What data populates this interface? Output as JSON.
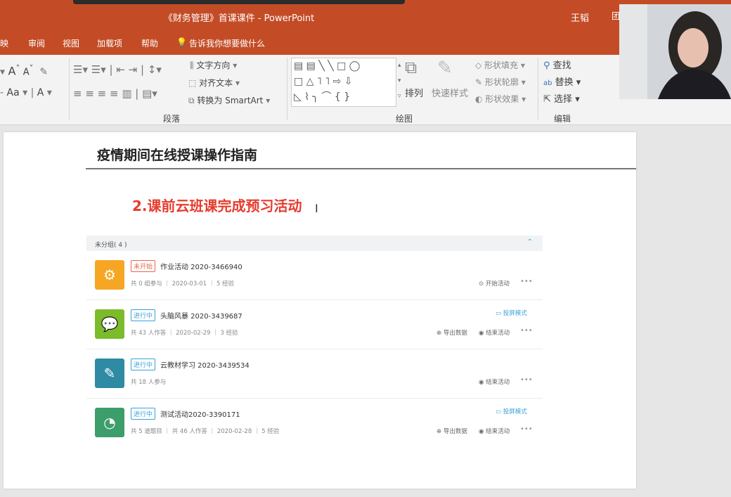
{
  "window": {
    "title": "《财务管理》首课课件 - PowerPoint",
    "user": "王韬",
    "extra": "团"
  },
  "menu": [
    "映",
    "审阅",
    "视图",
    "加载项",
    "帮助",
    "告诉我你想要做什么"
  ],
  "ribbon": {
    "font_group": {
      "grow": "A",
      "shrink": "A",
      "aa": "Aa",
      "a": "A"
    },
    "paragraph": {
      "text_direction": "文字方向",
      "align_text": "对齐文本",
      "smartart": "转换为 SmartArt",
      "label": "段落"
    },
    "drawing": {
      "arrange": "排列",
      "quick_styles": "快速样式",
      "shape_fill": "形状填充",
      "shape_outline": "形状轮廓",
      "shape_effects": "形状效果",
      "label": "绘图"
    },
    "editing": {
      "find": "查找",
      "replace": "替换",
      "select": "选择",
      "label": "编辑"
    }
  },
  "slide": {
    "title": "疫情期间在线授课操作指南",
    "subtitle": "2.课前云班课完成预习活动",
    "panel": {
      "group_label": "未分组( 4 )",
      "items": [
        {
          "badge": "未开始",
          "name": "作业活动 2020-3466940",
          "meta": "共 0 组参与 ｜ 2020-03-01 ｜ 5 经验",
          "actions": [
            "开始活动"
          ],
          "projection": ""
        },
        {
          "badge": "进行中",
          "name": "头脑风暴 2020-3439687",
          "meta": "共 43 人作答 ｜ 2020-02-29 ｜ 3 经验",
          "actions": [
            "导出数据",
            "结束活动"
          ],
          "projection": "投屏模式"
        },
        {
          "badge": "进行中",
          "name": "云教材学习 2020-3439534",
          "meta": "共 18 人参与",
          "actions": [
            "结束活动"
          ],
          "projection": ""
        },
        {
          "badge": "进行中",
          "name": "测试活动2020-3390171",
          "meta": "共 5 道题目 ｜ 共 46 人作答 ｜ 2020-02-28 ｜ 5 经验",
          "actions": [
            "导出数据",
            "结束活动"
          ],
          "projection": "投屏模式"
        }
      ]
    }
  },
  "colors": {
    "titlebar": "#c34c26",
    "accent_red": "#e63b2e",
    "blue": "#3aa1d8",
    "orange": "#f5a623",
    "green": "#7cbb2a",
    "teal": "#2f8aa3",
    "dark_green": "#3c9e6a"
  },
  "icons": [
    "lightbulb-icon",
    "find-icon",
    "replace-icon",
    "select-icon",
    "chevron-up-icon",
    "play-icon",
    "stop-icon",
    "export-icon",
    "projector-icon",
    "more-icon"
  ]
}
